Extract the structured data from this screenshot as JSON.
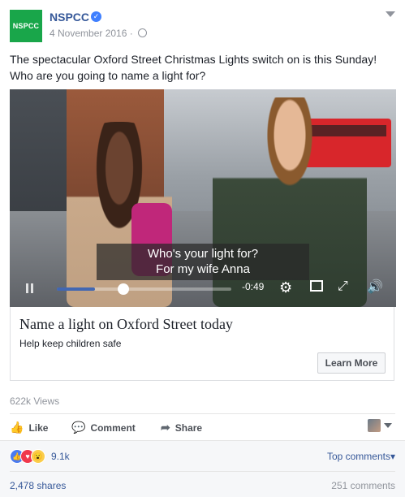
{
  "post": {
    "page_name": "NSPCC",
    "avatar_text": "NSPCC",
    "date": "4 November 2016",
    "text": "The spectacular Oxford Street Christmas Lights switch on is this Sunday! Who are you going to name a light for?"
  },
  "video": {
    "subtitle_line1": "Who's your light for?",
    "subtitle_line2": "For my wife Anna",
    "time_remaining": "-0:49",
    "progress": 0.22
  },
  "link": {
    "title": "Name a light on Oxford Street today",
    "subtitle": "Help keep children safe",
    "button_label": "Learn More"
  },
  "stats": {
    "views": "622k Views",
    "reaction_count": "9.1k",
    "top_comments": "Top comments",
    "shares": "2,478 shares",
    "comments": "251 comments"
  },
  "actions": {
    "like": "Like",
    "comment": "Comment",
    "share": "Share"
  },
  "colors": {
    "brand_green": "#19a64a",
    "link_blue": "#365899"
  }
}
